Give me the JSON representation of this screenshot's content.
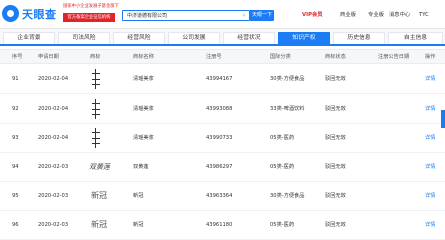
{
  "app": {
    "logo_text": "天眼查",
    "promo_line1": "国家中小企业发展子基金旗下",
    "promo_line2": "官方备案企业征信机构"
  },
  "search": {
    "value": "中济道德有限公司",
    "button": "天眼一下"
  },
  "topnav": {
    "vip": "VIP会员",
    "item2": "商业版",
    "item3": "专业版",
    "item4": "消息中心",
    "item5": "TYC"
  },
  "tabs": [
    {
      "label": "企业背景"
    },
    {
      "label": "司法风险"
    },
    {
      "label": "经营风险"
    },
    {
      "label": "公司发展"
    },
    {
      "label": "经营状况"
    },
    {
      "label": "知识产权"
    },
    {
      "label": "历史信息"
    },
    {
      "label": "自主信息"
    }
  ],
  "table": {
    "headers": [
      "序号",
      "申请日期",
      "商标",
      "商标名称",
      "注册号",
      "国际分类",
      "商标状态",
      "注册公告日期",
      "操作"
    ],
    "rows": [
      {
        "num": "91",
        "date": "2020-02-04",
        "mark": "calligraphy",
        "name": "清瑶美浆",
        "reg": "43994167",
        "cls": "30类-方便食品",
        "status": "驳回无效",
        "op": "详情"
      },
      {
        "num": "92",
        "date": "2020-02-04",
        "mark": "calligraphy",
        "name": "清瑶美浆",
        "reg": "43993088",
        "cls": "33类-啤酒饮料",
        "status": "驳回无效",
        "op": "详情"
      },
      {
        "num": "93",
        "date": "2020-02-04",
        "mark": "calligraphy",
        "name": "清瑶美浆",
        "reg": "43990733",
        "cls": "05类-医药",
        "status": "驳回无效",
        "op": "详情"
      },
      {
        "num": "94",
        "date": "2020-02-03",
        "mark": "双黄莲",
        "name": "双黄莲",
        "reg": "43986297",
        "cls": "05类-医药",
        "status": "驳回无效",
        "op": "详情"
      },
      {
        "num": "95",
        "date": "2020-02-03",
        "mark": "新冠",
        "name": "新冠",
        "reg": "43963364",
        "cls": "30类-方便食品",
        "status": "驳回无效",
        "op": "详情"
      },
      {
        "num": "96",
        "date": "2020-02-03",
        "mark": "新冠",
        "name": "新冠",
        "reg": "43961180",
        "cls": "05类-医药",
        "status": "驳回无效",
        "op": "详情"
      }
    ]
  },
  "colors": {
    "accent": "#1b7cf4",
    "vip": "#e1242a"
  }
}
